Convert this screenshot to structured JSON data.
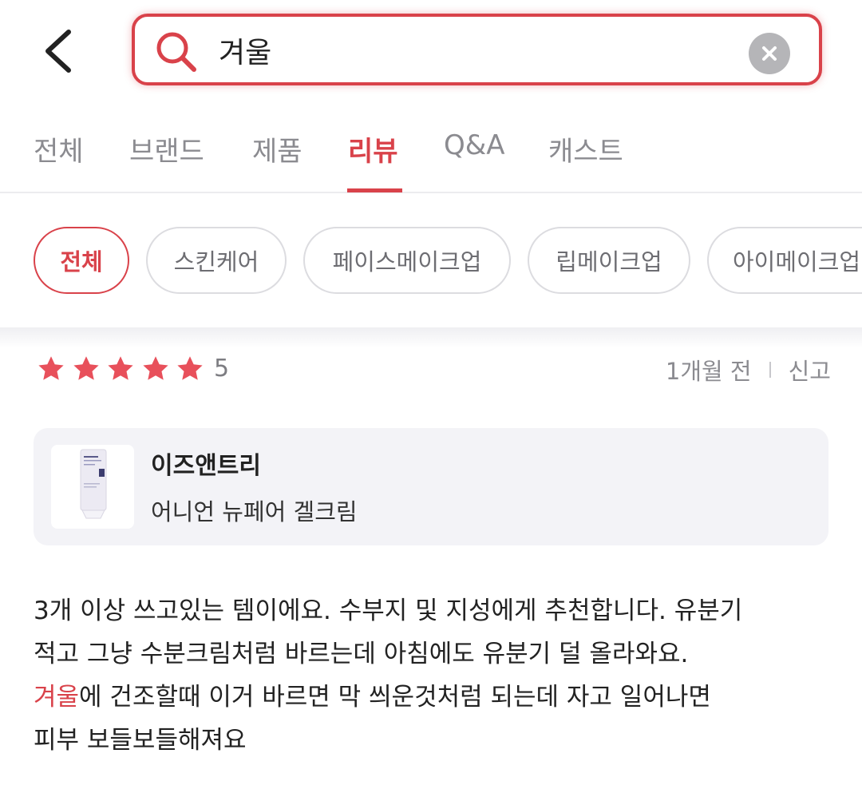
{
  "search": {
    "query": "겨울"
  },
  "tabs": [
    "전체",
    "브랜드",
    "제품",
    "리뷰",
    "Q&A",
    "캐스트"
  ],
  "active_tab": "리뷰",
  "chips": [
    "전체",
    "스킨케어",
    "페이스메이크업",
    "립메이크업",
    "아이메이크업"
  ],
  "active_chip": "전체",
  "review": {
    "rating": "5",
    "stars": 5,
    "time": "1개월 전",
    "report_label": "신고",
    "brand": "이즈앤트리",
    "product": "어니언 뉴페어 겔크림",
    "text_line1": "3개 이상 쓰고있는 템이에요. 수부지 및 지성에게 추천합니다. 유분기",
    "text_line2": "적고 그냥 수분크림처럼 바르는데 아침에도 유분기 덜 올라와요.",
    "text_line3_highlight": "겨울",
    "text_line3_rest": "에 건조할때 이거 바르면 막 씌운것처럼 되는데 자고 일어나면",
    "text_line4": "피부 보들보들해져요"
  },
  "colors": {
    "accent": "#d9424a",
    "star": "#e8505b",
    "inactive_text": "#8b8b90",
    "card_bg": "#f3f3f7"
  },
  "icons": [
    "back-arrow-icon",
    "search-icon",
    "clear-icon",
    "star-icon"
  ]
}
